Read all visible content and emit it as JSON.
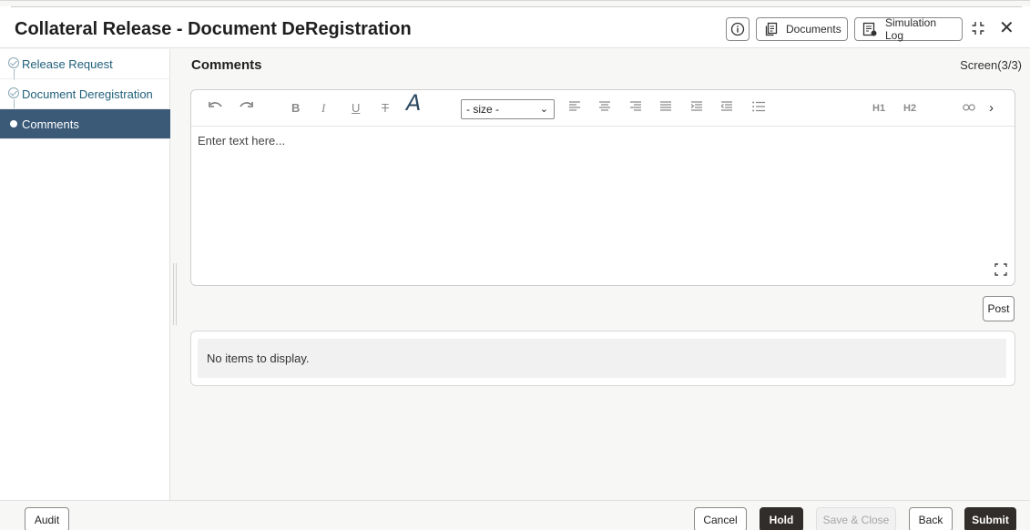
{
  "header": {
    "title": "Collateral Release - Document DeRegistration",
    "documents_label": "Documents",
    "simulation_log_label": "Simulation Log"
  },
  "sidebar": {
    "items": [
      {
        "label": "Release Request",
        "state": "completed"
      },
      {
        "label": "Document Deregistration",
        "state": "completed"
      },
      {
        "label": "Comments",
        "state": "active"
      }
    ]
  },
  "main": {
    "title": "Comments",
    "screen_indicator": "Screen(3/3)",
    "editor": {
      "size_select": "- size -",
      "placeholder": "Enter text here...",
      "toolbar_icons": [
        "undo-icon",
        "redo-icon",
        "bold-icon",
        "italic-icon",
        "underline-icon",
        "strikethrough-icon",
        "font-icon",
        "align-left-icon",
        "align-center-icon",
        "align-right-icon",
        "align-justify-icon",
        "indent-icon",
        "outdent-icon",
        "bullet-list-icon",
        "heading1-icon",
        "heading2-icon",
        "link-icon",
        "more-icon"
      ],
      "bold_label": "B",
      "italic_label": "I",
      "underline_label": "U",
      "strike_label": "T",
      "font_label": "A",
      "h1_label": "H1",
      "h2_label": "H2"
    },
    "post_label": "Post",
    "list_empty_text": "No items to display."
  },
  "footer": {
    "audit_label": "Audit",
    "cancel_label": "Cancel",
    "hold_label": "Hold",
    "save_close_label": "Save & Close",
    "back_label": "Back",
    "submit_label": "Submit"
  },
  "colors": {
    "active_sidebar": "#3a5a78",
    "sidebar_link": "#1f5f7a",
    "primary_dark": "#312d2a"
  }
}
